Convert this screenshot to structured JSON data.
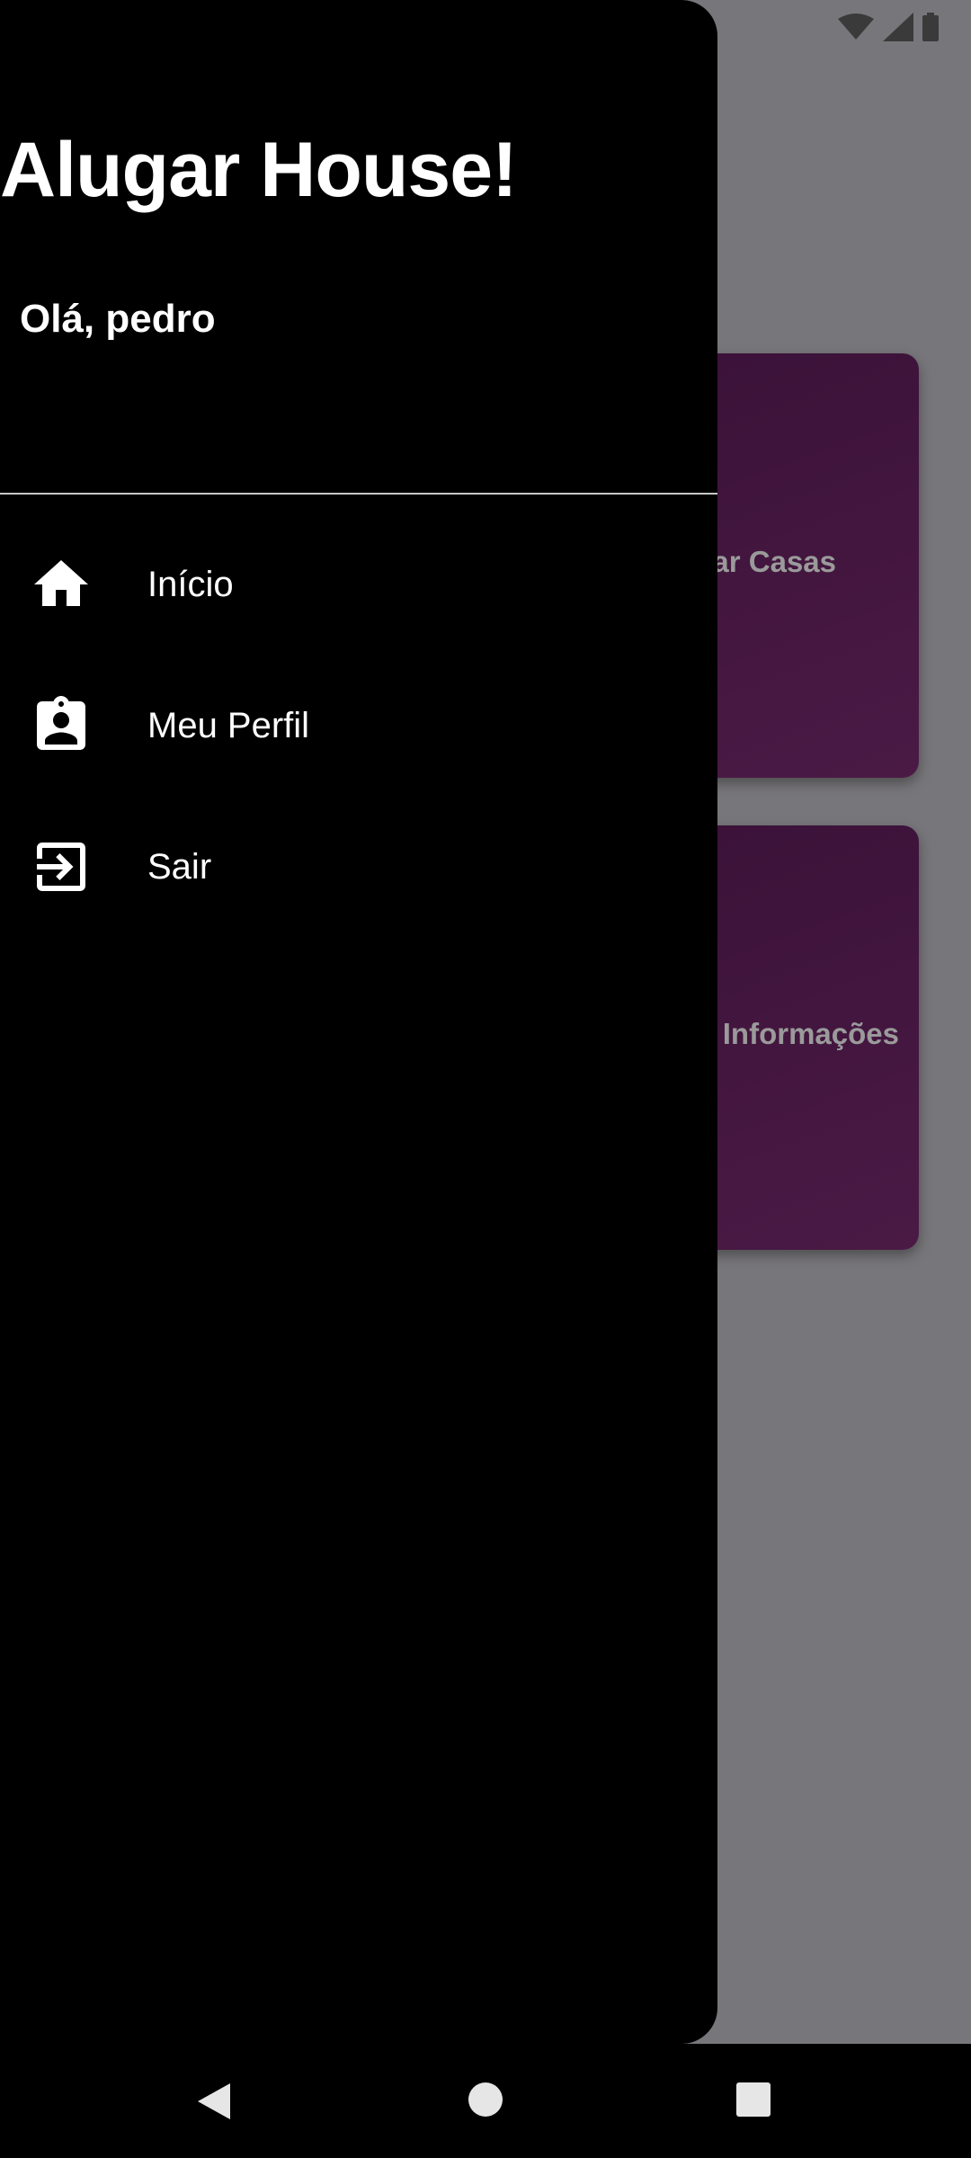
{
  "background": {
    "cards": [
      {
        "label": "ar Casas"
      },
      {
        "label": "Informações"
      }
    ]
  },
  "drawer": {
    "title": "Alugar House!",
    "greeting": "Olá, pedro",
    "items": [
      {
        "label": "Início",
        "icon": "home-icon"
      },
      {
        "label": "Meu Perfil",
        "icon": "badge-icon"
      },
      {
        "label": "Sair",
        "icon": "exit-icon"
      }
    ]
  },
  "colors": {
    "drawer_bg": "#000000",
    "scrim": "#77767a",
    "card": "#3b1239"
  }
}
